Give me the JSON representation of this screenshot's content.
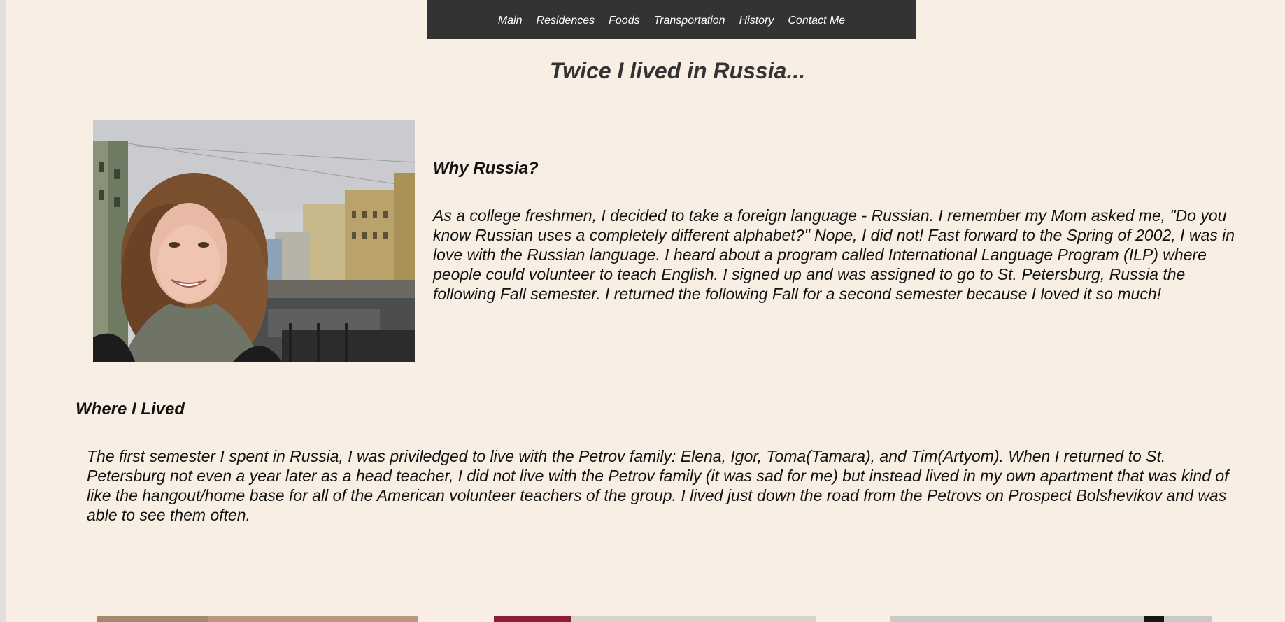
{
  "nav": {
    "items": [
      "Main",
      "Residences",
      "Foods",
      "Transportation",
      "History",
      "Contact Me"
    ]
  },
  "header": {
    "title": "Twice I lived in Russia..."
  },
  "why": {
    "title": "Why Russia?",
    "body": "As a college freshmen, I decided to take a foreign language - Russian. I remember my Mom asked me, \"Do you know Russian uses a completely different alphabet?\" Nope, I did not! Fast forward to the Spring of 2002, I was in love with the Russian language. I heard about a program called  International Language Program (ILP) where people could volunteer to teach English. I signed up and was assigned to go to St. Petersburg, Russia the following Fall semester. I returned the following Fall for a second semester because I loved it so much!"
  },
  "where": {
    "title": "Where I Lived",
    "body": "The first semester I spent in Russia, I was priviledged to live with the Petrov family: Elena, Igor, Toma(Tamara), and Tim(Artyom). When I returned to St. Petersburg not even a year later as a head teacher, I did not live with the Petrov family (it was sad for me) but instead lived in my own apartment that was kind of like the hangout/home base for all of the American volunteer teachers of the group. I lived just down the road from the Petrovs on Prospect Bolshevikov and was able to see them often."
  },
  "colors": {
    "background": "#f9eee4",
    "nav_background": "#333333",
    "nav_text": "#ffffff",
    "title_text": "#333333"
  }
}
